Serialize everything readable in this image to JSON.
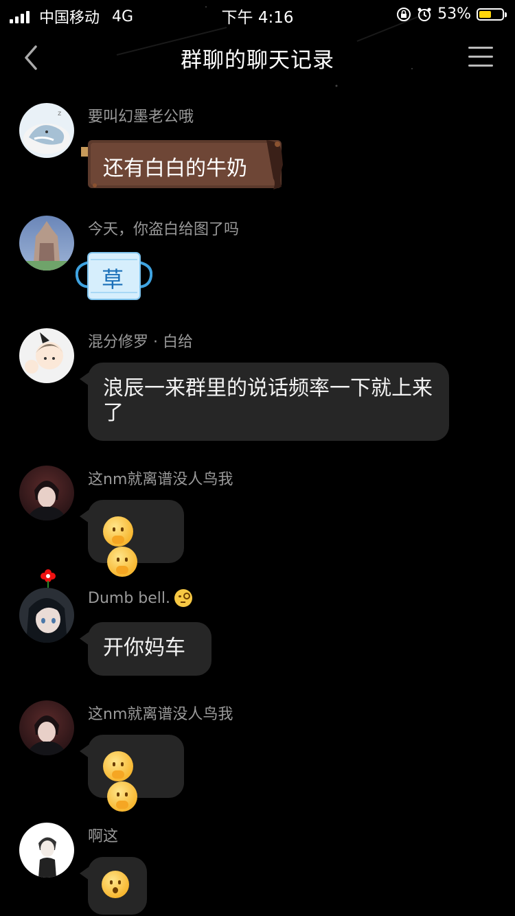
{
  "status_bar": {
    "carrier": "中国移动",
    "network": "4G",
    "time": "下午 4:16",
    "battery_percent": "53%",
    "battery_level": 0.53
  },
  "header": {
    "title": "群聊的聊天记录",
    "back_icon": "chevron-left-icon",
    "menu_icon": "hamburger-menu-icon"
  },
  "messages": [
    {
      "sender": "要叫幻墨老公哦",
      "text": "还有白白的牛奶",
      "style": "wooden-sign"
    },
    {
      "sender": "今天，你盗白给图了吗",
      "sticker_text": "草",
      "style": "sticker"
    },
    {
      "sender": "混分修罗 · 白给",
      "text": "浪辰一来群里的说话频率一下就上来了"
    },
    {
      "sender": "这nm就离谱没人鸟我",
      "emoji": "thinking-hands-emoji x2"
    },
    {
      "sender": "Dumb bell.",
      "sender_badge_icon": "monocle-face-emoji",
      "text": "开你妈车"
    },
    {
      "sender": "这nm就离谱没人鸟我",
      "emoji": "thinking-hands-emoji x2"
    },
    {
      "sender": "啊这",
      "emoji": "hushed-face-emoji"
    }
  ],
  "colors": {
    "background": "#000000",
    "bubble": "#262626",
    "sender_text": "#9a9a9a",
    "battery_fill": "#ffd60a"
  }
}
